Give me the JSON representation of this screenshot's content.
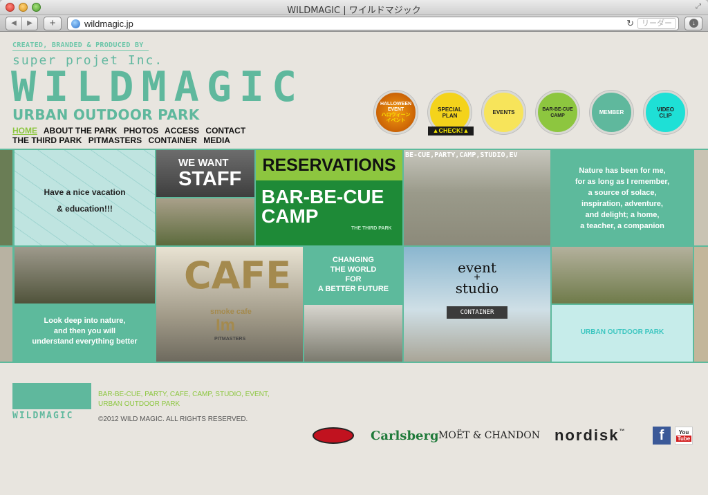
{
  "window": {
    "title": "WILDMAGIC | ワイルドマジック"
  },
  "browser": {
    "url": "wildmagic.jp",
    "reader": "リーダー"
  },
  "header": {
    "credit": "CREATED, BRANDED & PRODUCED BY",
    "company": "super projet Inc.",
    "logo": "WILDMAGIC",
    "subtitle": "URBAN OUTDOOR PARK"
  },
  "nav": {
    "items": [
      "HOME",
      "ABOUT THE PARK",
      "PHOTOS",
      "ACCESS",
      "CONTACT",
      "THE THIRD PARK",
      "PITMASTERS",
      "CONTAINER",
      "MEDIA"
    ]
  },
  "circles": {
    "halloween_1": "HALLOWEEN",
    "halloween_2": "EVENT",
    "halloween_3": "ハロウィーン",
    "halloween_4": "イベント",
    "special": "SPECIAL\nPLAN",
    "check": "▲CHECK!▲",
    "events": "EVENTS",
    "bbq": "BAR-BE-CUE\nCAMP",
    "member": "MEMBER",
    "video": "VIDEO\nCLIP"
  },
  "tiles": {
    "vacation_1": "Have a nice vacation",
    "vacation_2": "& education!!!",
    "staff_1": "WE WANT",
    "staff_2": "STAFF",
    "reservations": "RESERVATIONS",
    "bbq_1": "BAR-BE-CUE",
    "bbq_2": "CAMP",
    "third_park": "THE THIRD PARK",
    "banner": "BE-CUE,PARTY,CAMP,STUDIO,EV",
    "quote": "Nature has been for me,\nfor as long as I remember,\na source of solace,\ninspiration, adventure,\nand delight; a home,\na teacher, a companion",
    "deep": "Look deep into nature,\nand then you will\nunderstand everything better",
    "cafe": "CAFE",
    "smoke_cafe": "smoke cafe",
    "im": "Im",
    "pitmasters": "PITMASTERS",
    "changing": "CHANGING\nTHE WORLD\nFOR\nA BETTER FUTURE",
    "event": "event",
    "plus": "+",
    "studio": "studio",
    "container": "CONTAINER",
    "urban": "URBAN OUTDOOR PARK"
  },
  "footer": {
    "logo": "WILDMAGIC",
    "keywords": "BAR-BE-CUE, PARTY, CAFE, CAMP, STUDIO, EVENT,\nURBAN OUTDOOR PARK",
    "copyright": "©2012 WILD MAGIC. ALL RIGHTS RESERVED.",
    "carlsberg": "Carlsberg",
    "moet": "MOËT & CHANDON",
    "nordisk": "nordisk",
    "trademark": "™",
    "facebook": "f",
    "you": "You",
    "tube": "Tube"
  }
}
